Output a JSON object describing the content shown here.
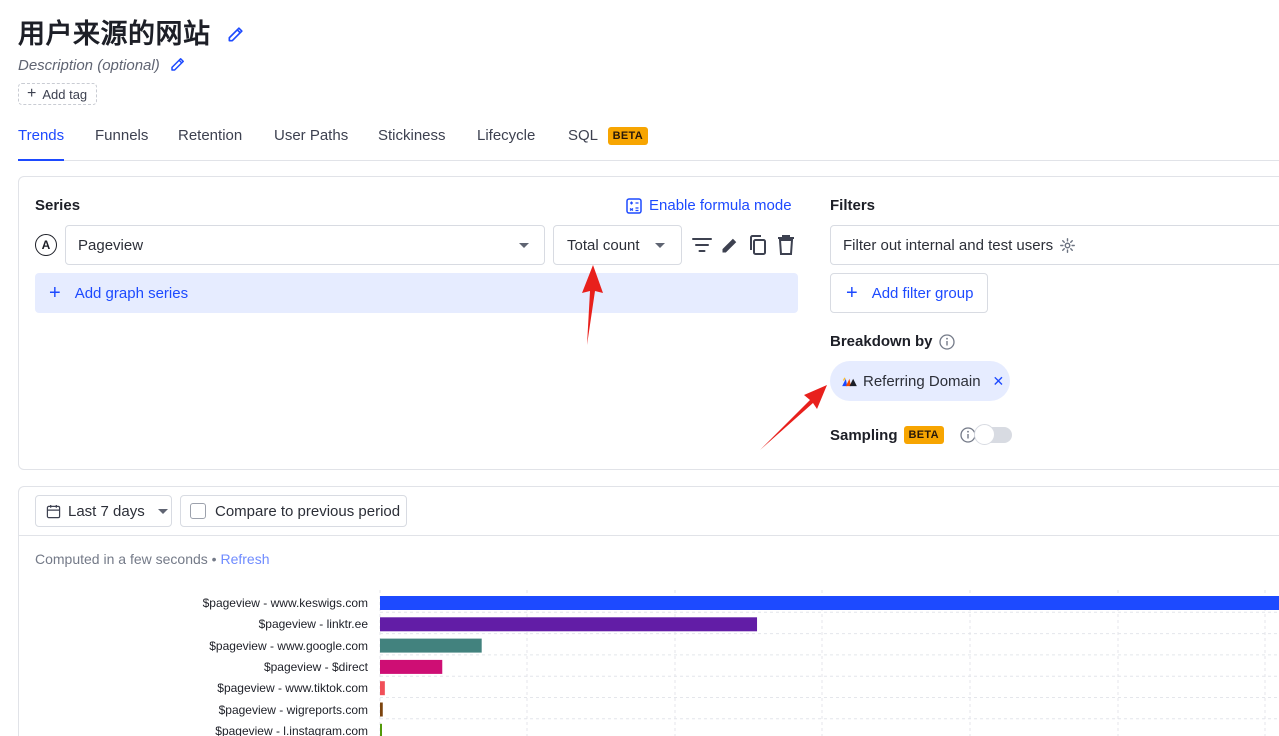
{
  "header": {
    "title": "用户来源的网站",
    "description": "Description (optional)",
    "add_tag_label": "Add tag"
  },
  "tabs": [
    {
      "label": "Trends",
      "active": true
    },
    {
      "label": "Funnels"
    },
    {
      "label": "Retention"
    },
    {
      "label": "User Paths"
    },
    {
      "label": "Stickiness"
    },
    {
      "label": "Lifecycle"
    },
    {
      "label": "SQL",
      "badge": "BETA"
    }
  ],
  "series": {
    "heading": "Series",
    "formula_label": "Enable formula mode",
    "letter": "A",
    "event": "Pageview",
    "aggregation": "Total count",
    "add_label": "Add graph series"
  },
  "filters": {
    "heading": "Filters",
    "internal_label": "Filter out internal and test users",
    "add_group_label": "Add filter group"
  },
  "breakdown": {
    "heading": "Breakdown by",
    "chip_label": "Referring Domain"
  },
  "sampling": {
    "heading": "Sampling",
    "badge": "BETA",
    "enabled": false
  },
  "toolbar": {
    "date_range": "Last 7 days",
    "compare_label": "Compare to previous period"
  },
  "status": {
    "computed": "Computed in a few seconds",
    "separator": "•",
    "refresh": "Refresh"
  },
  "colors": {
    "accent": "#1d4aff",
    "beta": "#f7a501",
    "annotation_arrow": "#e8201c"
  },
  "chart_data": {
    "type": "bar",
    "orientation": "horizontal",
    "categories": [
      "$pageview - www.keswigs.com",
      "$pageview - linktr.ee",
      "$pageview - www.google.com",
      "$pageview - $direct",
      "$pageview - www.tiktok.com",
      "$pageview - wigreports.com",
      "$pageview - l.instagram.com"
    ],
    "values": [
      100,
      54.5,
      14.7,
      9,
      0.7,
      0.4,
      0.2
    ],
    "colors": [
      "#1d4aff",
      "#621da6",
      "#42827e",
      "#ce0e74",
      "#f14f58",
      "#7c440e",
      "#529a0a"
    ],
    "grid": true
  }
}
